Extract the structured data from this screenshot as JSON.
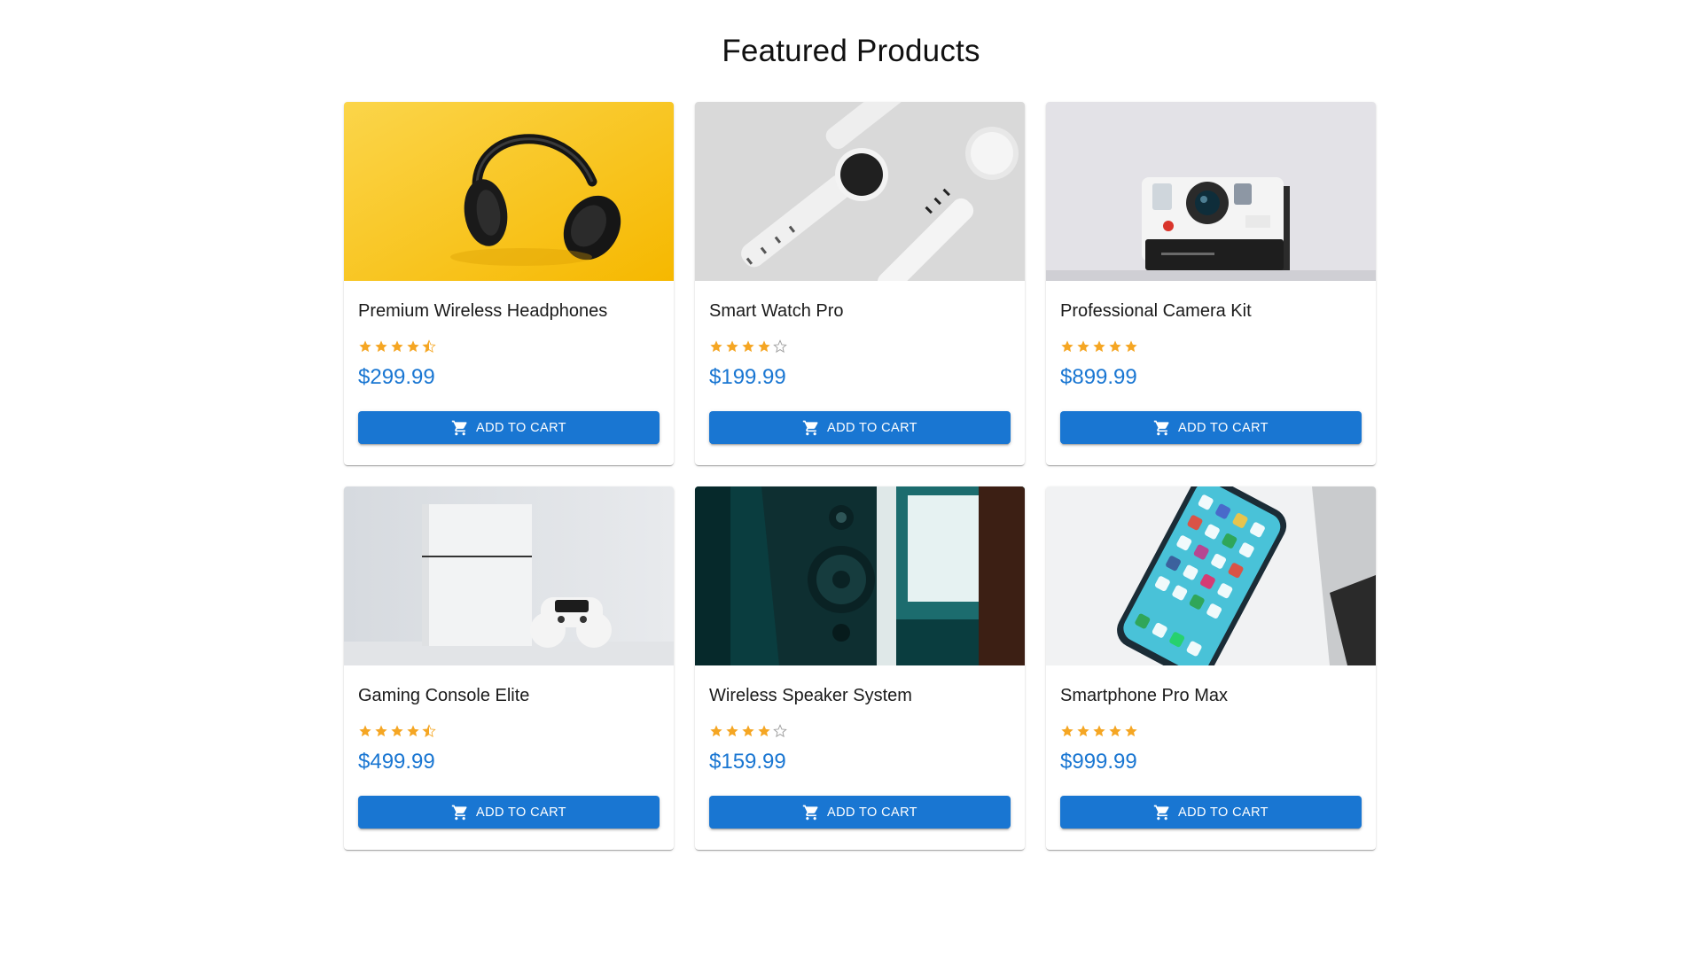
{
  "header": {
    "title": "Featured Products"
  },
  "colors": {
    "primary": "#1976d2",
    "star": "#f5a623",
    "star_empty": "#9e9e9e"
  },
  "products": [
    {
      "name": "Premium Wireless Headphones",
      "rating": 4.5,
      "rating_max": 5,
      "price": "$299.99",
      "button_label": "Add to Cart",
      "image": "headphones"
    },
    {
      "name": "Smart Watch Pro",
      "rating": 4,
      "rating_max": 5,
      "price": "$199.99",
      "button_label": "Add to Cart",
      "image": "smartwatch"
    },
    {
      "name": "Professional Camera Kit",
      "rating": 5,
      "rating_max": 5,
      "price": "$899.99",
      "button_label": "Add to Cart",
      "image": "camera"
    },
    {
      "name": "Gaming Console Elite",
      "rating": 4.5,
      "rating_max": 5,
      "price": "$499.99",
      "button_label": "Add to Cart",
      "image": "console"
    },
    {
      "name": "Wireless Speaker System",
      "rating": 4,
      "rating_max": 5,
      "price": "$159.99",
      "button_label": "Add to Cart",
      "image": "speaker"
    },
    {
      "name": "Smartphone Pro Max",
      "rating": 5,
      "rating_max": 5,
      "price": "$999.99",
      "button_label": "Add to Cart",
      "image": "smartphone"
    }
  ]
}
